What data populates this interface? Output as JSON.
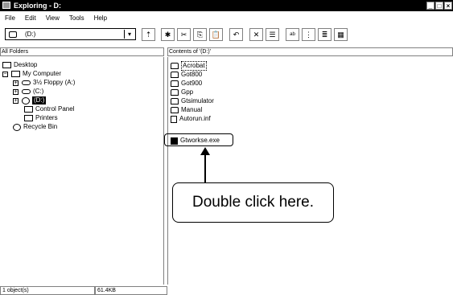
{
  "window": {
    "title": "Exploring - D:",
    "buttons": [
      "_",
      "□",
      "×"
    ]
  },
  "menu": [
    "File",
    "Edit",
    "View",
    "Tools",
    "Help"
  ],
  "toolbar": {
    "address_value": "(D:)",
    "buttons": [
      "⇡",
      "✱",
      "✂",
      "⎘",
      "📋",
      "↶",
      "✕",
      "☰",
      "ᵃᵇ",
      "⋮",
      "≣",
      "▦"
    ]
  },
  "panes": {
    "left_header": "All Folders",
    "right_header": "Contents of '(D:)'"
  },
  "tree": [
    {
      "label": "Desktop",
      "glyph": "",
      "icon": "desktop"
    },
    {
      "label": "My Computer",
      "glyph": "−",
      "icon": "computer"
    },
    {
      "label": "3½ Floppy (A:)",
      "glyph": "+",
      "icon": "floppy"
    },
    {
      "label": "(C:)",
      "glyph": "+",
      "icon": "drive"
    },
    {
      "label": "(D:)",
      "glyph": "+",
      "icon": "cd"
    },
    {
      "label": "Control Panel",
      "glyph": "",
      "icon": "control-panel"
    },
    {
      "label": "Printers",
      "glyph": "",
      "icon": "printer"
    },
    {
      "label": "Recycle Bin",
      "glyph": "",
      "icon": "recycle"
    }
  ],
  "files": [
    {
      "name": "Acrobat",
      "type": "folder"
    },
    {
      "name": "Got800",
      "type": "folder"
    },
    {
      "name": "Got900",
      "type": "folder"
    },
    {
      "name": "Gpp",
      "type": "folder"
    },
    {
      "name": "Gtsimulator",
      "type": "folder"
    },
    {
      "name": "Manual",
      "type": "folder"
    },
    {
      "name": "Autorun.inf",
      "type": "document"
    },
    {
      "name": "Gtworkse.exe",
      "type": "exe"
    }
  ],
  "annotation": {
    "callout": "Double click here."
  },
  "status": {
    "objects": "1 object(s)",
    "size": "61.4KB"
  }
}
